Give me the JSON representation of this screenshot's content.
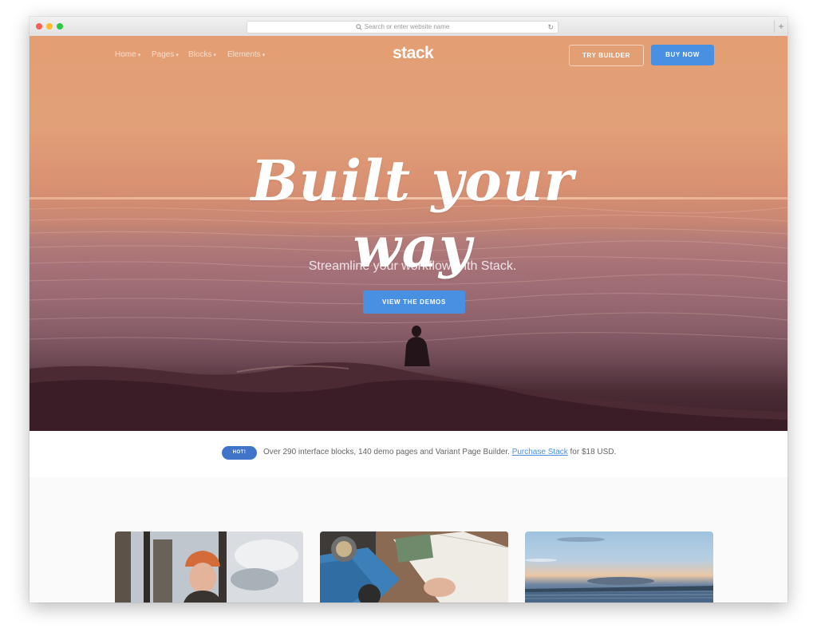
{
  "browser": {
    "url_placeholder": "Search or enter website name",
    "search_icon": "magnifier-icon",
    "reload_icon": "reload-icon",
    "new_tab_icon": "plus-icon"
  },
  "nav": {
    "items": [
      {
        "label": "Home"
      },
      {
        "label": "Pages"
      },
      {
        "label": "Blocks"
      },
      {
        "label": "Elements"
      }
    ],
    "logo": "stack",
    "try_builder": "TRY BUILDER",
    "buy_now": "BUY NOW"
  },
  "hero": {
    "headline": "Built your way",
    "subheadline": "Streamline your workflow with Stack.",
    "cta": "VIEW THE DEMOS"
  },
  "announcement": {
    "badge": "HOT!",
    "text_before": "Over 290 interface blocks, 140 demo pages and Variant Page Builder.",
    "link": "Purchase Stack",
    "text_after": "for $18 USD."
  },
  "colors": {
    "accent": "#4a90e2",
    "badge": "#3f74c9"
  }
}
